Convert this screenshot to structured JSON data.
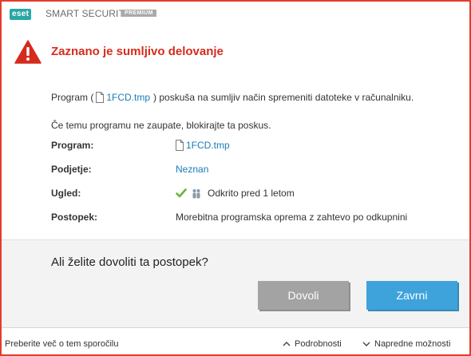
{
  "window": {
    "logo": "eset",
    "product": "SMART SECURITY",
    "edition": "PREMIUM",
    "accent_color": "#e53b2f"
  },
  "alert": {
    "title": "Zaznano je sumljivo delovanje",
    "icon": "warning-triangle-icon",
    "color": "#d52b1e"
  },
  "description": {
    "line1_prefix": "Program (",
    "file": "1FCD.tmp",
    "line1_suffix": ") poskuša na sumljiv način spremeniti datoteke v računalniku.",
    "line2": "Če temu programu ne zaupate, blokirajte ta poskus."
  },
  "details": {
    "program": {
      "label": "Program:",
      "value": "1FCD.tmp"
    },
    "company": {
      "label": "Podjetje:",
      "value": "Neznan"
    },
    "reputation": {
      "label": "Ugled:",
      "value": "Odkrito pred 1 letom"
    },
    "operation": {
      "label": "Postopek:",
      "value": "Morebitna programska oprema z zahtevo po odkupnini"
    }
  },
  "prompt": {
    "question": "Ali želite dovoliti ta postopek?",
    "allow_label": "Dovoli",
    "deny_label": "Zavrni"
  },
  "footer": {
    "learn_more": "Preberite več o tem sporočilu",
    "details": "Podrobnosti",
    "advanced": "Napredne možnosti"
  }
}
